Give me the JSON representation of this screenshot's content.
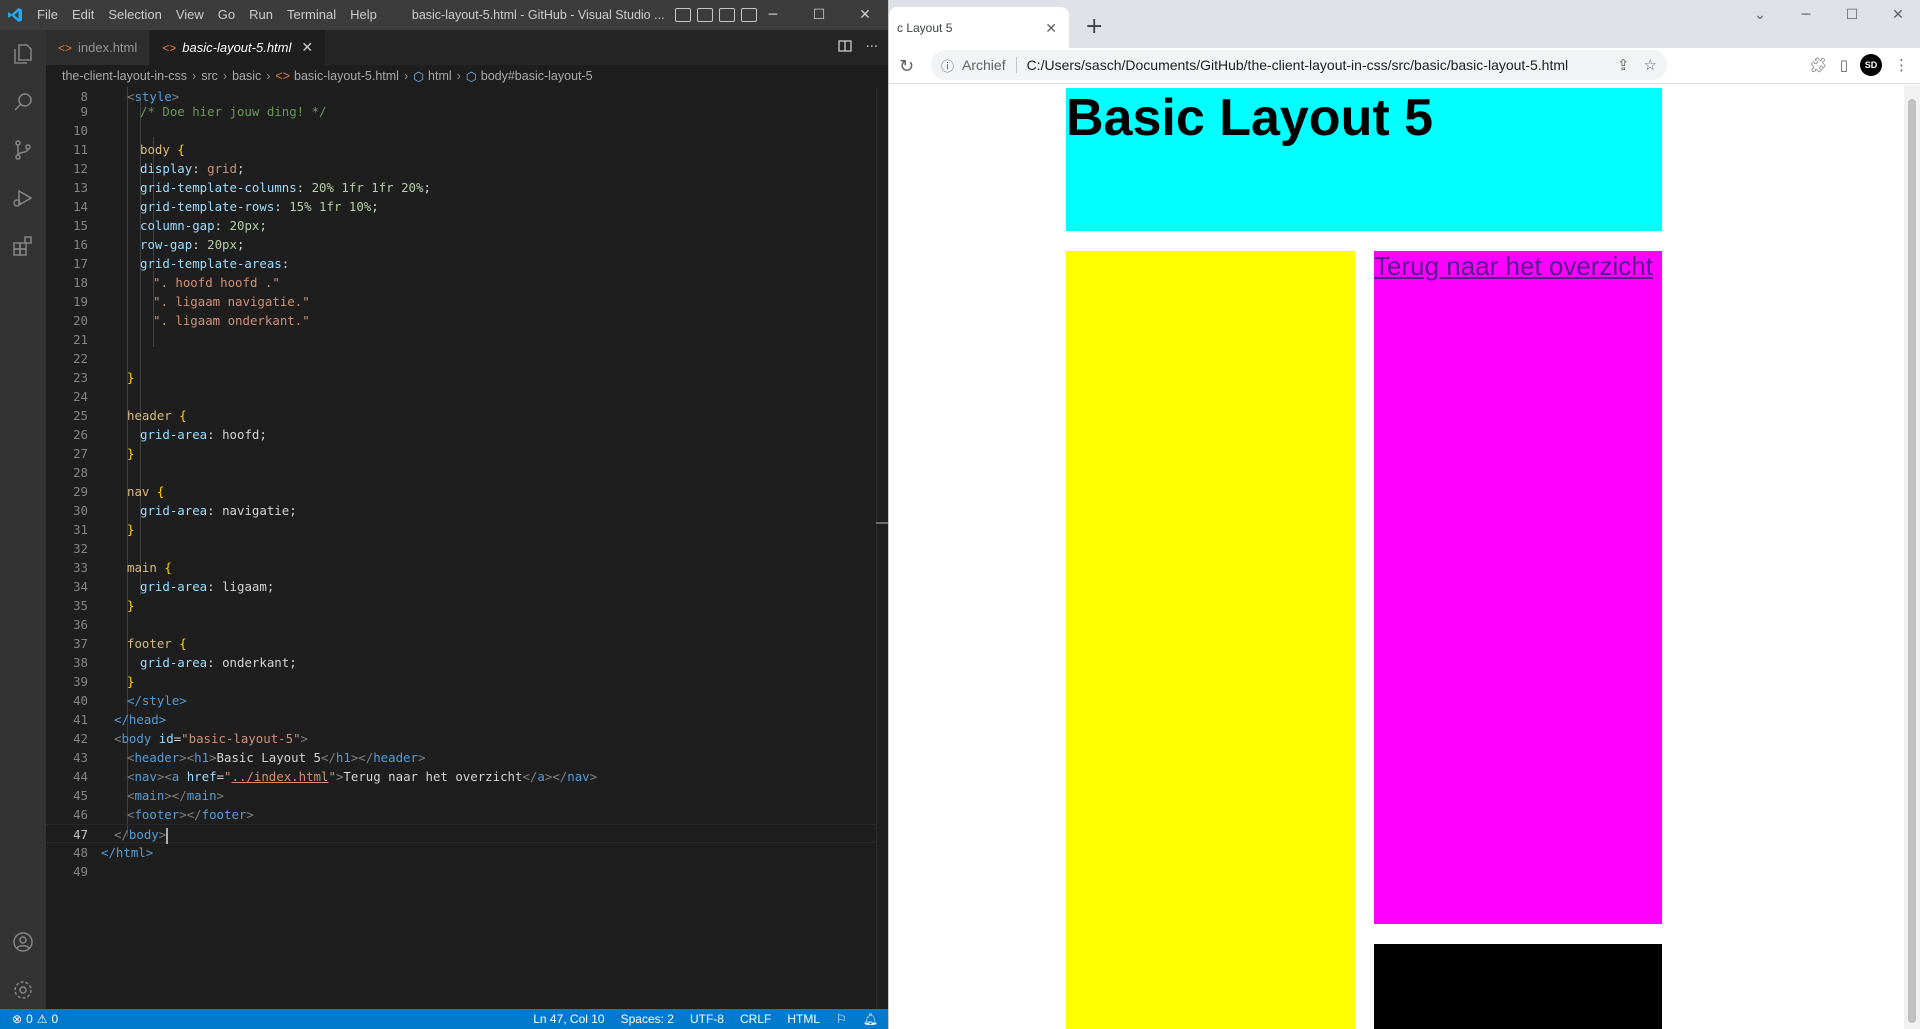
{
  "vscode": {
    "menu": [
      "File",
      "Edit",
      "Selection",
      "View",
      "Go",
      "Run",
      "Terminal",
      "Help"
    ],
    "window_title": "basic-layout-5.html - GitHub - Visual Studio ...",
    "tabs": [
      {
        "label": "index.html",
        "active": false
      },
      {
        "label": "basic-layout-5.html",
        "active": true
      }
    ],
    "breadcrumb": [
      "the-client-layout-in-css",
      "src",
      "basic",
      "basic-layout-5.html",
      "html",
      "body#basic-layout-5"
    ],
    "status": {
      "errors": "0",
      "warnings": "0",
      "position": "Ln 47, Col 10",
      "spaces": "Spaces: 2",
      "encoding": "UTF-8",
      "eol": "CRLF",
      "language": "HTML"
    }
  },
  "code": {
    "l8": "<style>",
    "l9": "/* Doe hier jouw ding! */",
    "l11_sel": "body",
    "l12_p": "display",
    "l12_v": "grid",
    "l13_p": "grid-template-columns",
    "l13_v": "20% 1fr 1fr 20%",
    "l14_p": "grid-template-rows",
    "l14_v": "15% 1fr 10%",
    "l15_p": "column-gap",
    "l15_v": "20px",
    "l16_p": "row-gap",
    "l16_v": "20px",
    "l17_p": "grid-template-areas",
    "l18": "\". hoofd hoofd .\"",
    "l19": "\". ligaam navigatie.\"",
    "l20": "\". ligaam onderkant.\"",
    "l25_sel": "header",
    "l26_p": "grid-area",
    "l26_v": "hoofd",
    "l29_sel": "nav",
    "l30_p": "grid-area",
    "l30_v": "navigatie",
    "l33_sel": "main",
    "l34_p": "grid-area",
    "l34_v": "ligaam",
    "l37_sel": "footer",
    "l38_p": "grid-area",
    "l38_v": "onderkant",
    "l40": "</style>",
    "l41": "</head>",
    "l42_attr": "id",
    "l42_val": "\"basic-layout-5\"",
    "l43_text": "Basic Layout 5",
    "l44_attr": "href",
    "l44_val": "../index.html",
    "l44_text": "Terug naar het overzicht",
    "l48": "</html>"
  },
  "chrome": {
    "tab_title": "c Layout 5",
    "omni_label": "Archief",
    "url": "C:/Users/sasch/Documents/GitHub/the-client-layout-in-css/src/basic/basic-layout-5.html",
    "profile_initials": "SD"
  },
  "page": {
    "h1": "Basic Layout 5",
    "nav_link": "Terug naar het overzicht",
    "colors": {
      "header": "#00ffff",
      "main": "#ffff00",
      "nav": "#ff00ff",
      "footer": "#000000"
    }
  }
}
